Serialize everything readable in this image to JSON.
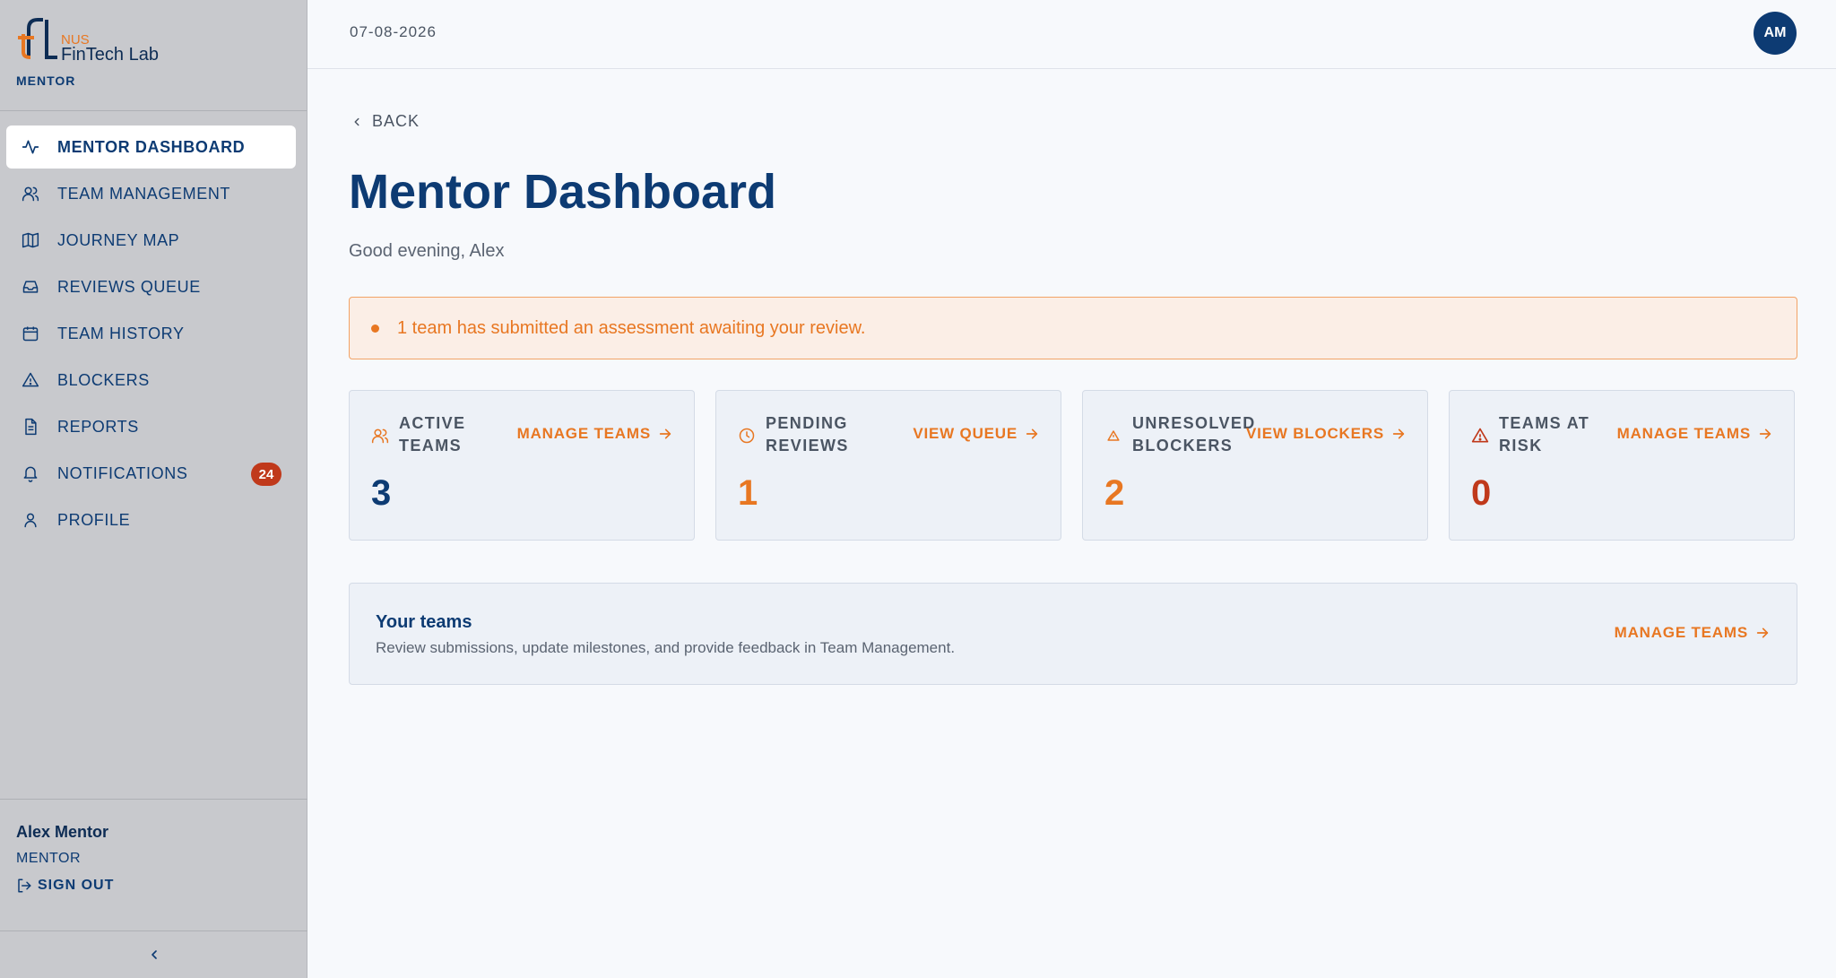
{
  "brand": {
    "nus": "NUS",
    "name": "FinTech Lab",
    "role": "MENTOR"
  },
  "sidebar": {
    "items": [
      {
        "label": "MENTOR DASHBOARD",
        "icon": "activity-icon",
        "active": true
      },
      {
        "label": "TEAM MANAGEMENT",
        "icon": "users-icon"
      },
      {
        "label": "JOURNEY MAP",
        "icon": "map-icon"
      },
      {
        "label": "REVIEWS QUEUE",
        "icon": "inbox-icon"
      },
      {
        "label": "TEAM HISTORY",
        "icon": "calendar-icon"
      },
      {
        "label": "BLOCKERS",
        "icon": "warning-icon"
      },
      {
        "label": "REPORTS",
        "icon": "document-icon"
      },
      {
        "label": "NOTIFICATIONS",
        "icon": "bell-icon",
        "badge": "24"
      },
      {
        "label": "PROFILE",
        "icon": "user-icon"
      }
    ],
    "user": {
      "name": "Alex Mentor",
      "role": "MENTOR",
      "signout": "SIGN OUT"
    }
  },
  "header": {
    "date": "07-08-2026",
    "avatar": "AM"
  },
  "main": {
    "back": "BACK",
    "title": "Mentor Dashboard",
    "greeting": "Good evening, Alex",
    "alert": "1 team has submitted an assessment awaiting your review.",
    "stats": [
      {
        "label": "ACTIVE TEAMS",
        "link": "MANAGE TEAMS",
        "value": "3",
        "icon": "users-icon",
        "color": "#0d3b73"
      },
      {
        "label": "PENDING REVIEWS",
        "link": "VIEW QUEUE",
        "value": "1",
        "icon": "clock-icon",
        "color": "#e87722"
      },
      {
        "label": "UNRESOLVED BLOCKERS",
        "link": "VIEW BLOCKERS",
        "value": "2",
        "icon": "warning-icon",
        "color": "#e87722"
      },
      {
        "label": "TEAMS AT RISK",
        "link": "MANAGE TEAMS",
        "value": "0",
        "icon": "alert-triangle-icon",
        "color": "#c0391b"
      }
    ],
    "teams": {
      "title": "Your teams",
      "subtitle": "Review submissions, update milestones, and provide feedback in Team Management.",
      "link": "MANAGE TEAMS"
    }
  },
  "colors": {
    "primary": "#0d3b73",
    "accent": "#e87722",
    "danger": "#c0391b"
  }
}
